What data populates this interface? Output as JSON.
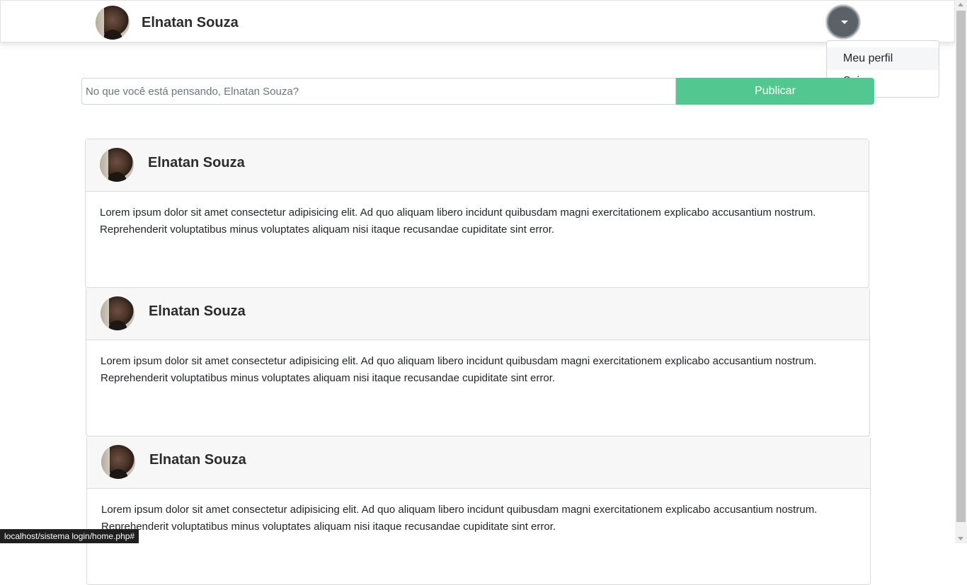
{
  "navbar": {
    "user_name": "Elnatan Souza"
  },
  "dropdown": {
    "items": [
      {
        "label": "Meu perfil"
      },
      {
        "label": "Sair"
      }
    ]
  },
  "post_form": {
    "placeholder": "No que você está pensando, Elnatan Souza?",
    "publish_label": "Publicar"
  },
  "posts": [
    {
      "author": "Elnatan Souza",
      "content": "Lorem ipsum dolor sit amet consectetur adipisicing elit. Ad quo aliquam libero incidunt quibusdam magni exercitationem explicabo accusantium nostrum. Reprehenderit voluptatibus minus voluptates aliquam nisi itaque recusandae cupiditate sint error."
    },
    {
      "author": "Elnatan Souza",
      "content": "Lorem ipsum dolor sit amet consectetur adipisicing elit. Ad quo aliquam libero incidunt quibusdam magni exercitationem explicabo accusantium nostrum. Reprehenderit voluptatibus minus voluptates aliquam nisi itaque recusandae cupiditate sint error."
    },
    {
      "author": "Elnatan Souza",
      "content": "Lorem ipsum dolor sit amet consectetur adipisicing elit. Ad quo aliquam libero incidunt quibusdam magni exercitationem explicabo accusantium nostrum. Reprehenderit voluptatibus minus voluptates aliquam nisi itaque recusandae cupiditate sint error."
    }
  ],
  "status_bar": {
    "url": "localhost/sistema login/home.php#"
  },
  "colors": {
    "publish_button": "#52c78f",
    "dropdown_toggle": "#5a6268"
  }
}
